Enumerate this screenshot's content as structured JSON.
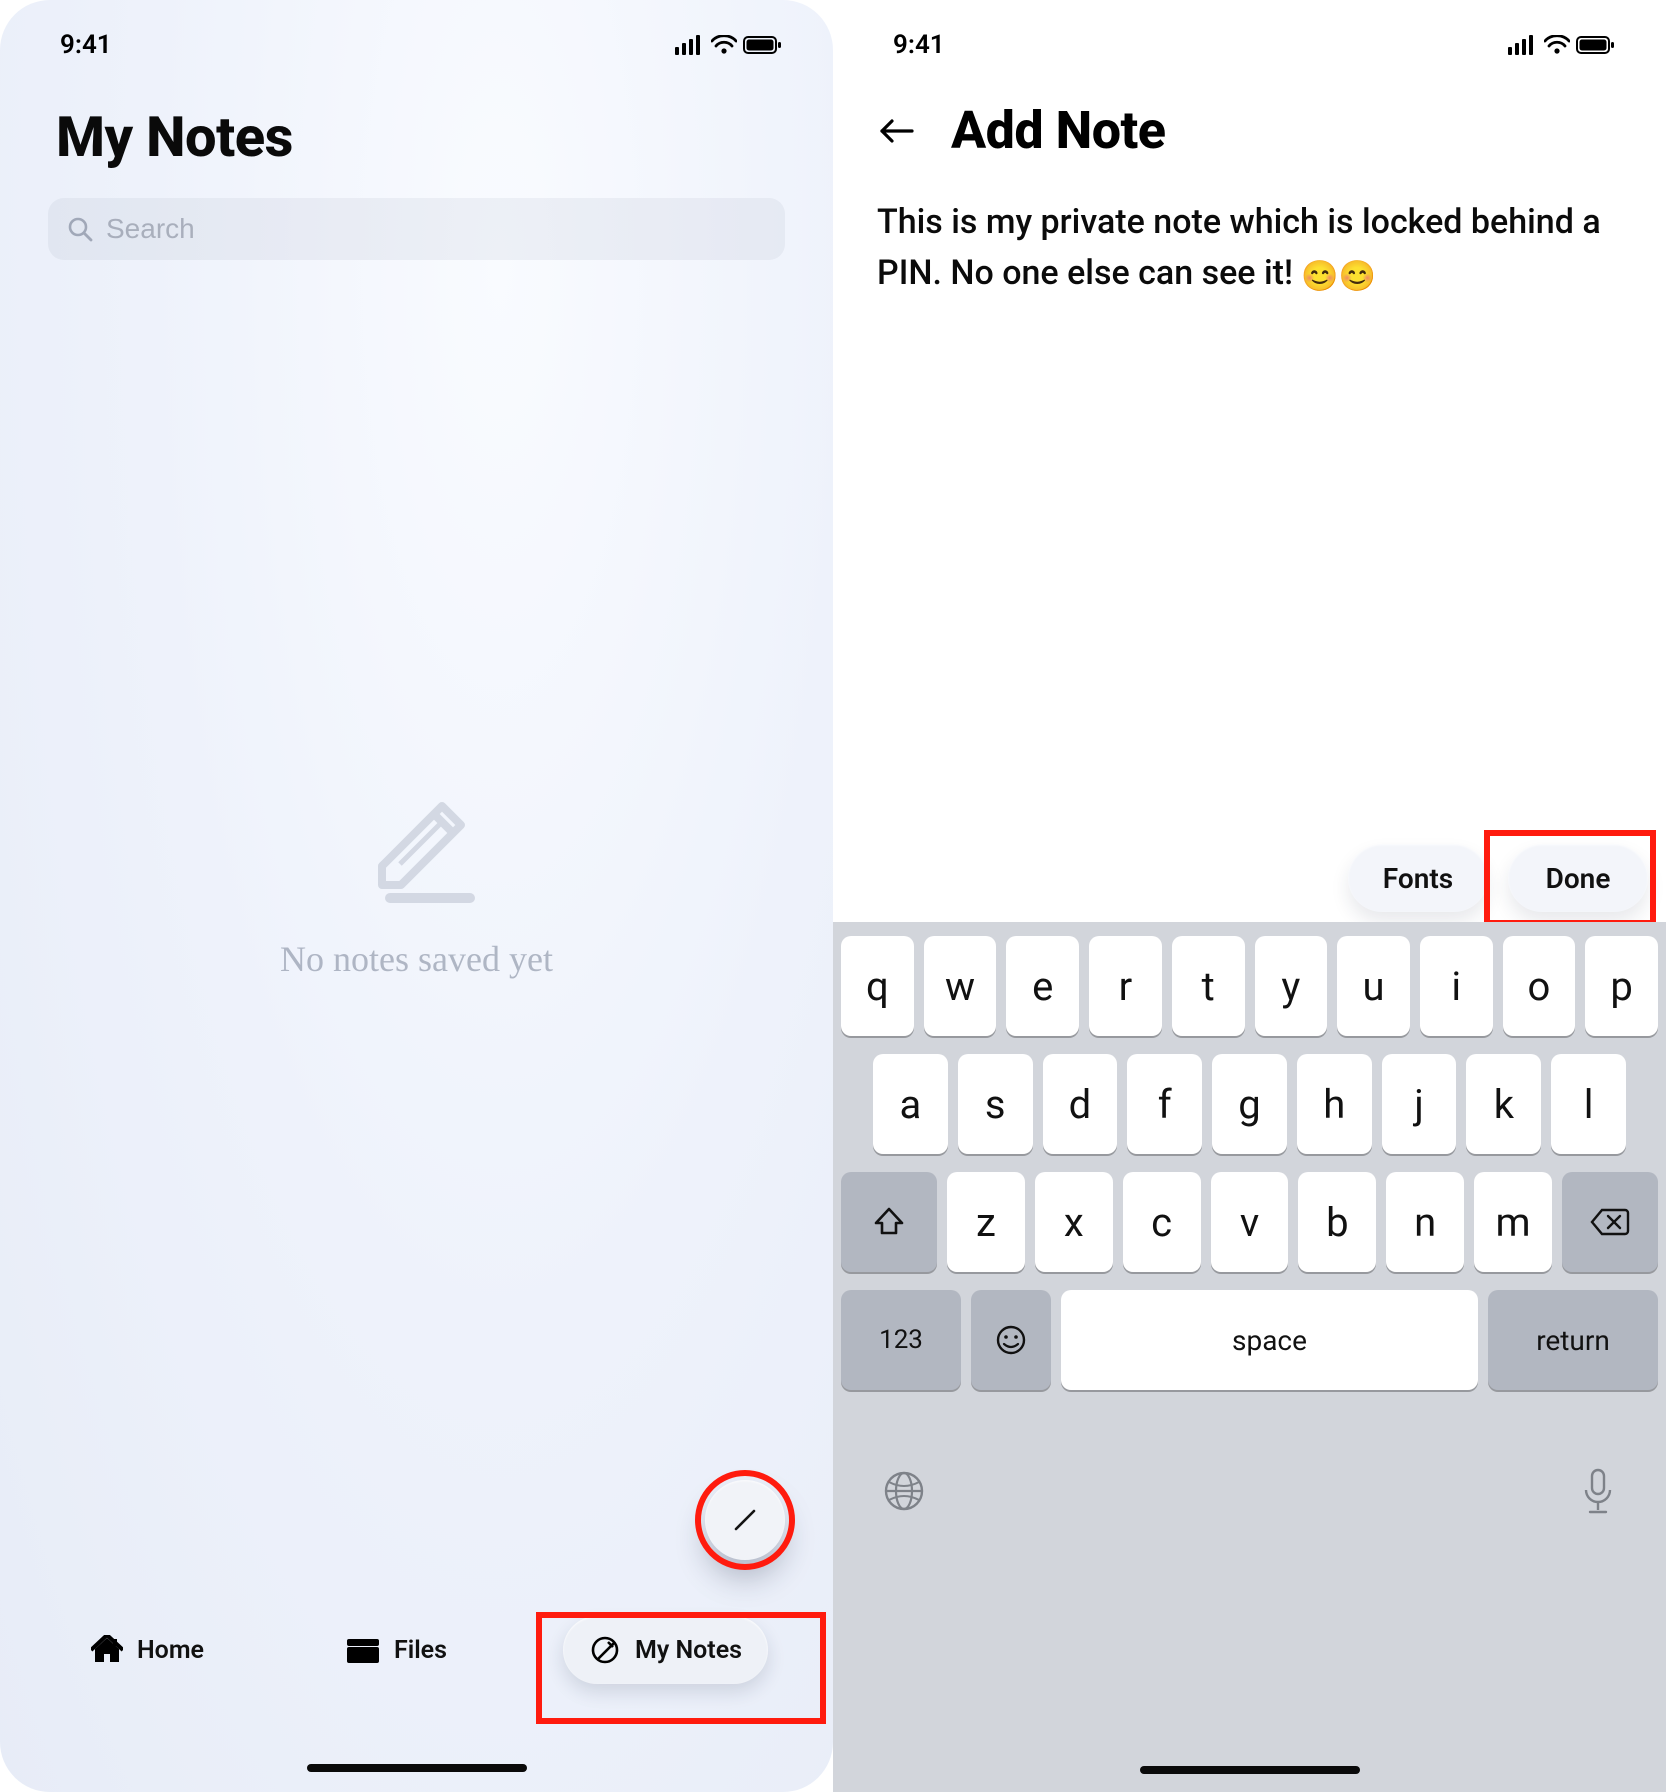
{
  "status": {
    "time": "9:41"
  },
  "left": {
    "title": "My Notes",
    "search_placeholder": "Search",
    "empty_text": "No notes saved yet",
    "tabs": {
      "home": "Home",
      "files": "Files",
      "notes": "My Notes"
    }
  },
  "right": {
    "title": "Add Note",
    "note_text": "This is my private note which is locked behind a PIN. No one else can see it!",
    "note_emoji": "😊😊",
    "toolbar": {
      "fonts": "Fonts",
      "done": "Done"
    }
  },
  "keyboard": {
    "row1": [
      "q",
      "w",
      "e",
      "r",
      "t",
      "y",
      "u",
      "i",
      "o",
      "p"
    ],
    "row2": [
      "a",
      "s",
      "d",
      "f",
      "g",
      "h",
      "j",
      "k",
      "l"
    ],
    "row3": [
      "z",
      "x",
      "c",
      "v",
      "b",
      "n",
      "m"
    ],
    "abc": "123",
    "space": "space",
    "return": "return"
  }
}
